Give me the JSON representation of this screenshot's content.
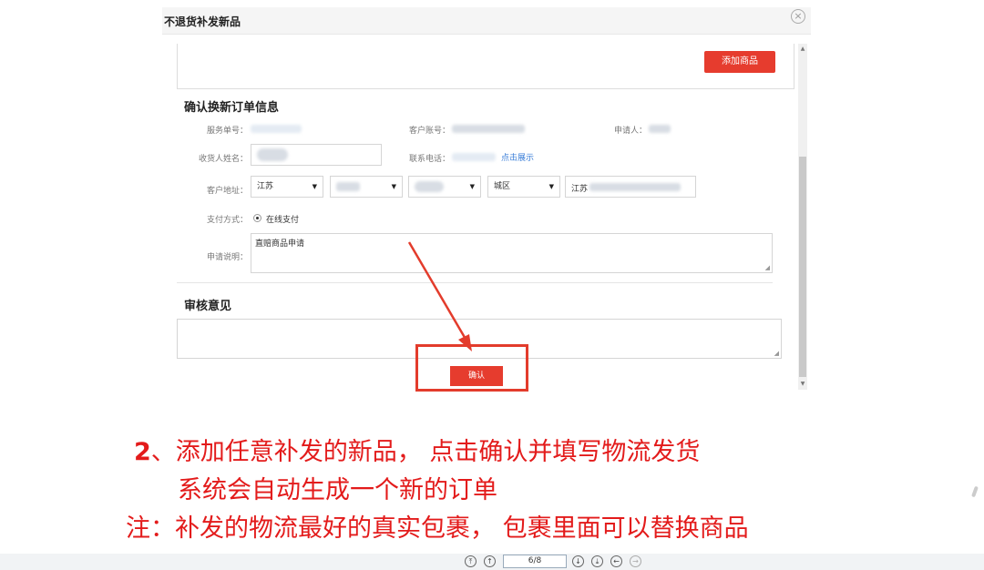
{
  "dialog": {
    "title": "不退货补发新品",
    "close_icon": "close-circle-icon",
    "add_product_label": "添加商品",
    "order_section_title": "确认换新订单信息",
    "service_no_label": "服务单号：",
    "customer_account_label": "客户账号：",
    "applicant_label": "申请人：",
    "receiver_name_label": "收货人姓名：",
    "contact_phone_label": "联系电话：",
    "click_show_label": "点击展示",
    "customer_address_label": "客户地址：",
    "province_select": "江苏",
    "district_select": "城区",
    "address_prefix": "江苏",
    "payment_label": "支付方式：",
    "payment_option": "在线支付",
    "apply_desc_label": "申请说明：",
    "apply_desc_value": "直赔商品申请",
    "review_section_title": "审核意见",
    "confirm_label": "确认"
  },
  "annotation": {
    "line1_num": "2",
    "line1_text": "、添加任意补发的新品， 点击确认并填写物流发货",
    "line2_text": "系统会自动生成一个新的订单",
    "line3_text": "注：补发的物流最好的真实包裹， 包裹里面可以替换商品",
    "accent_color": "#e31b1b"
  },
  "pager": {
    "page_value": "6/8"
  }
}
